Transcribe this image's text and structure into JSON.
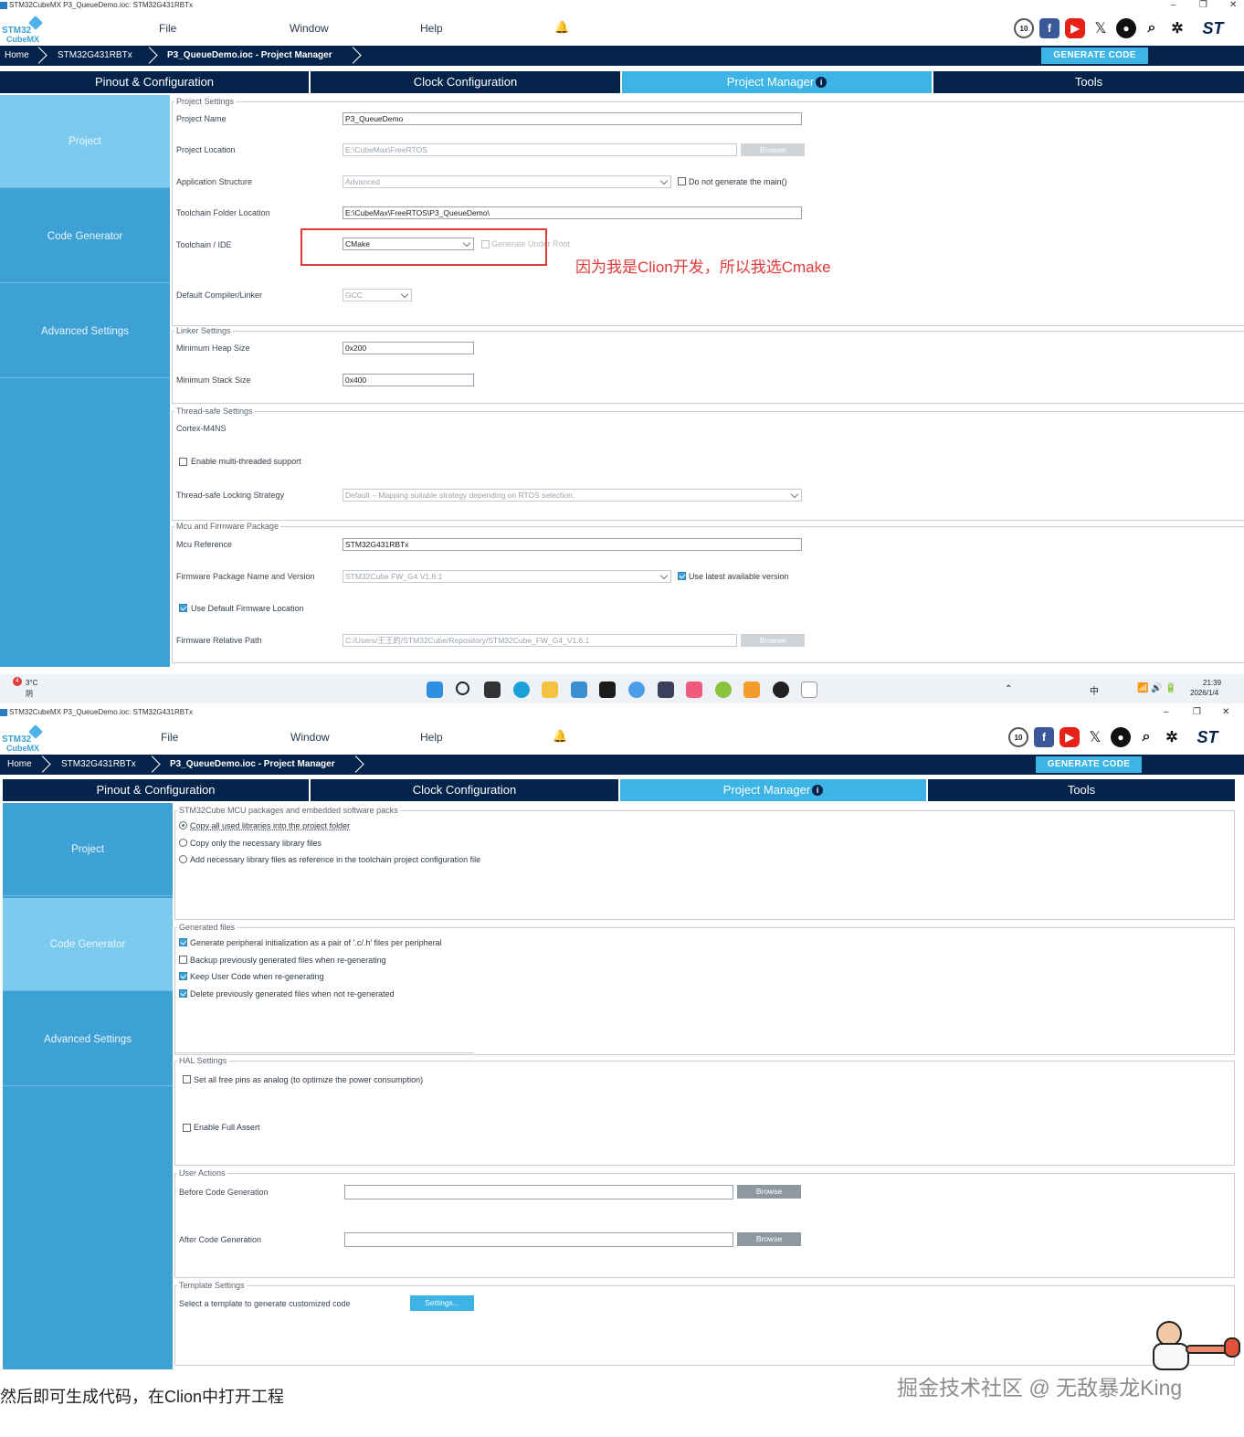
{
  "win1": {
    "title": "STM32CubeMX P3_QueueDemo.ioc: STM32G431RBTx",
    "menu": [
      "File",
      "Window",
      "Help"
    ],
    "logo_line1": "STM32",
    "logo_line2": "CubeMX",
    "win_controls": [
      "–",
      "❐",
      "✕"
    ],
    "breadcrumbs": [
      "Home",
      "STM32G431RBTx",
      "P3_QueueDemo.ioc - Project Manager"
    ],
    "generate": "GENERATE CODE",
    "tabs": [
      "Pinout & Configuration",
      "Clock Configuration",
      "Project Manager",
      "Tools"
    ],
    "side": [
      "Project",
      "Code Generator",
      "Advanced Settings"
    ],
    "project_settings": {
      "title": "Project Settings",
      "name_label": "Project Name",
      "name_value": "P3_QueueDemo",
      "location_label": "Project Location",
      "location_value": "E:\\CubeMax\\FreeRTOS",
      "browse": "Browse",
      "app_label": "Application Structure",
      "app_value": "Advanced",
      "no_main": "Do not generate the main()",
      "toolchain_folder_label": "Toolchain Folder Location",
      "toolchain_folder_value": "E:\\CubeMax\\FreeRTOS\\P3_QueueDemo\\",
      "ide_label": "Toolchain / IDE",
      "ide_value": "CMake",
      "under_root": "Generate Under Root",
      "compiler_label": "Default Compiler/Linker",
      "compiler_value": "GCC"
    },
    "annotation": "因为我是Clion开发，所以我选Cmake",
    "linker": {
      "title": "Linker Settings",
      "heap_label": "Minimum Heap Size",
      "heap_value": "0x200",
      "stack_label": "Minimum Stack Size",
      "stack_value": "0x400"
    },
    "thread": {
      "title": "Thread-safe Settings",
      "core": "Cortex-M4NS",
      "multi": "Enable multi-threaded support",
      "strategy_label": "Thread-safe Locking Strategy",
      "strategy_value": "Default – Mapping suitable strategy depending on RTOS selection."
    },
    "mcu": {
      "title": "Mcu and Firmware Package",
      "ref_label": "Mcu Reference",
      "ref_value": "STM32G431RBTx",
      "fw_label": "Firmware Package Name and Version",
      "fw_value": "STM32Cube FW_G4 V1.6.1",
      "latest": "Use latest available version",
      "default_loc": "Use Default Firmware Location",
      "path_label": "Firmware Relative Path",
      "path_value": "C:/Users/王王的/STM32Cube/Repository/STM32Cube_FW_G4_V1.6.1",
      "browse": "Browse"
    }
  },
  "taskbar": {
    "weather_badge": "4",
    "temp": "3°C",
    "cond": "阴",
    "time": "21:39",
    "date": "2026/1/4",
    "lang": "中"
  },
  "win2": {
    "title": "STM32CubeMX P3_QueueDemo.ioc: STM32G431RBTx",
    "menu": [
      "File",
      "Window",
      "Help"
    ],
    "logo_line1": "STM32",
    "logo_line2": "CubeMX",
    "win_controls": [
      "–",
      "❐",
      "✕"
    ],
    "breadcrumbs": [
      "Home",
      "STM32G431RBTx",
      "P3_QueueDemo.ioc - Project Manager"
    ],
    "generate": "GENERATE CODE",
    "tabs": [
      "Pinout & Configuration",
      "Clock Configuration",
      "Project Manager",
      "Tools"
    ],
    "side": [
      "Project",
      "Code Generator",
      "Advanced Settings"
    ],
    "packs": {
      "title": "STM32Cube MCU packages and embedded software packs",
      "opt1": "Copy all used libraries into the project folder",
      "opt2": "Copy only the necessary library files",
      "opt3": "Add necessary library files as reference in the toolchain project configuration file"
    },
    "generated": {
      "title": "Generated files",
      "g1": "Generate peripheral initialization as a pair of '.c/.h' files per peripheral",
      "g2": "Backup previously generated files when re-generating",
      "g3": "Keep User Code when re-generating",
      "g4": "Delete previously generated files when not re-generated"
    },
    "hal": {
      "title": "HAL Settings",
      "h1": "Set all free pins as analog (to optimize the power consumption)",
      "h2": "Enable Full Assert"
    },
    "user_actions": {
      "title": "User Actions",
      "before": "Before Code Generation",
      "after": "After Code Generation",
      "browse": "Browse"
    },
    "template": {
      "title": "Template Settings",
      "label": "Select a template to generate customized code",
      "button": "Settings..."
    }
  },
  "footer": "然后即可生成代码，在Clion中打开工程",
  "watermark": "掘金技术社区 @ 无敌暴龙King",
  "colors": {
    "navy": "#03234b",
    "accent": "#3cb4e5",
    "sidebar": "#3da1d6",
    "annotation_red": "#e23a3a"
  },
  "icons": [
    "cubemx-logo",
    "bell-icon",
    "anniversary-10-icon",
    "facebook-icon",
    "youtube-icon",
    "x-icon",
    "github-icon",
    "search-icon",
    "network-icon",
    "st-logo"
  ]
}
